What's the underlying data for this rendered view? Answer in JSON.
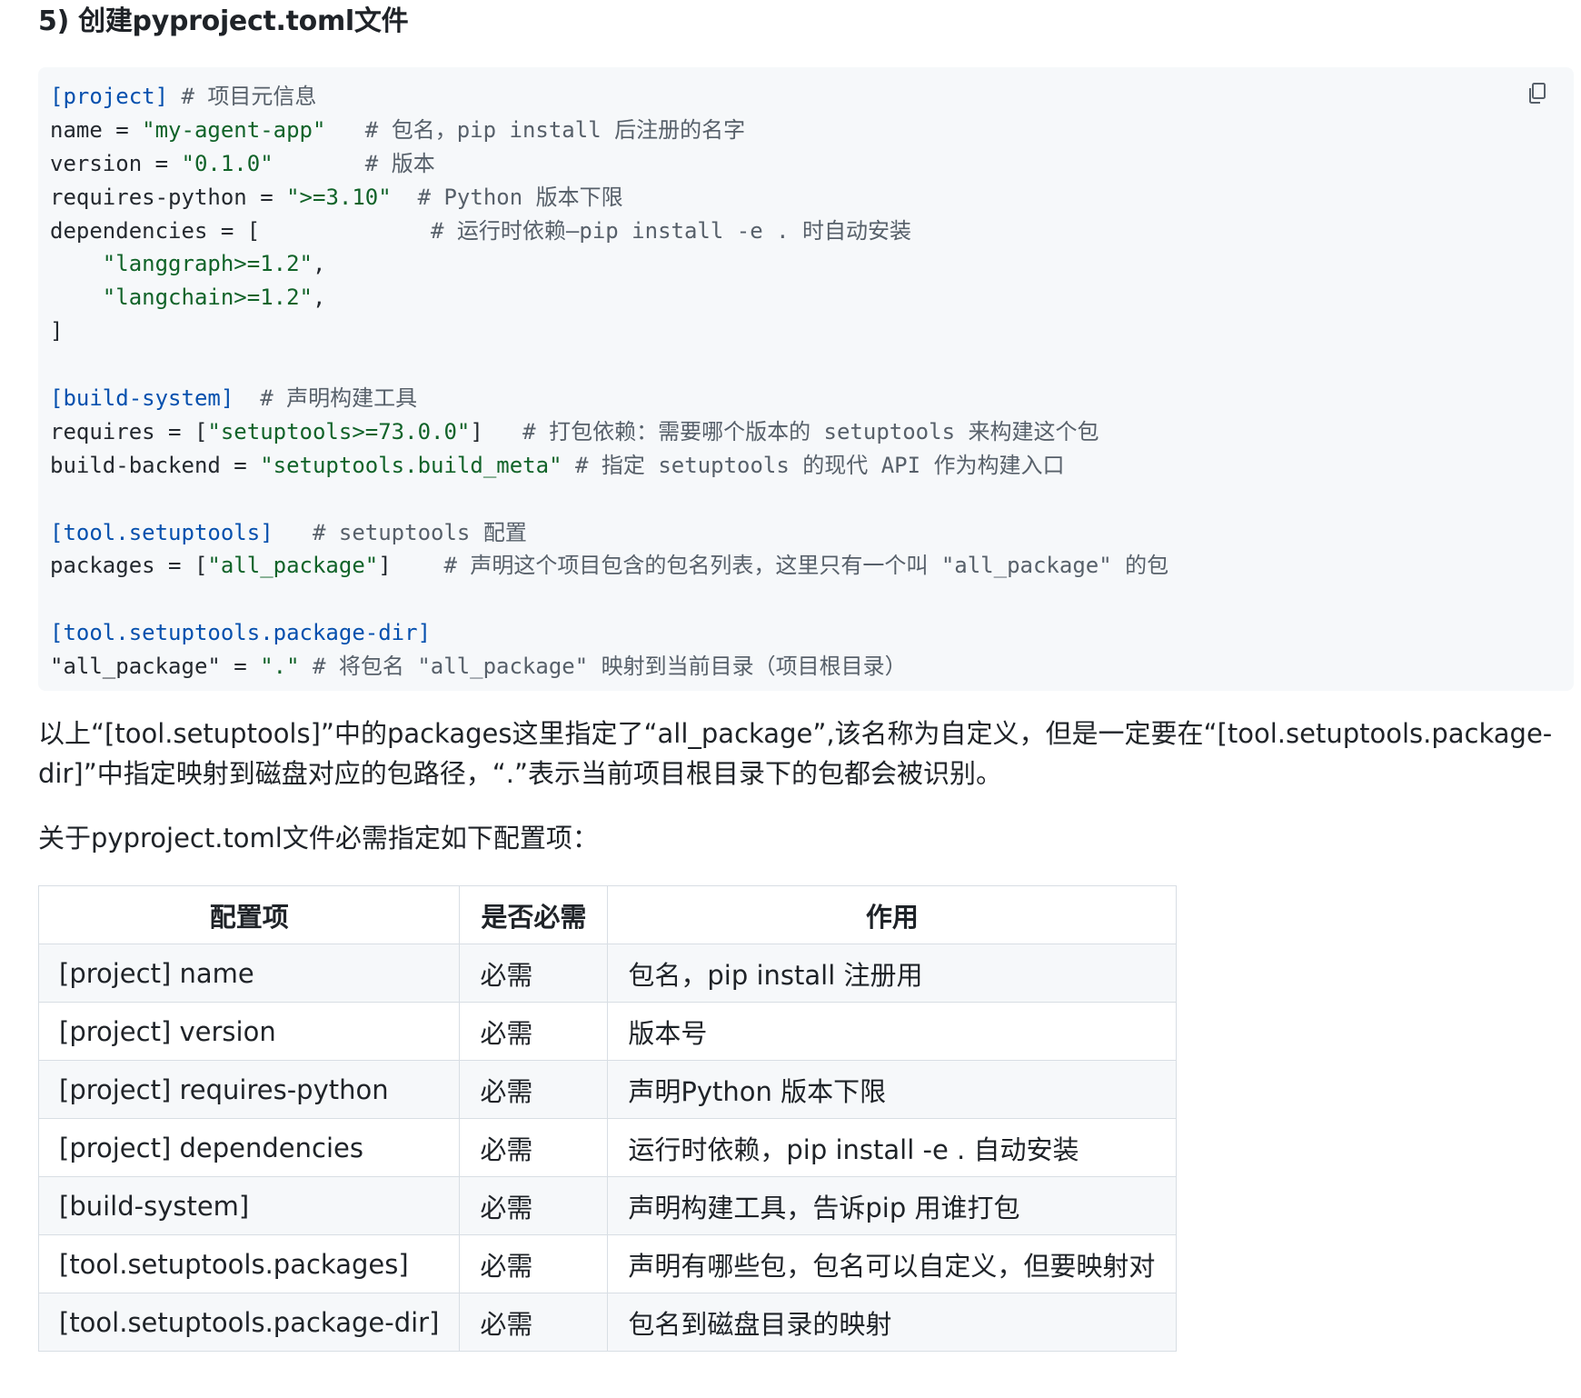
{
  "section_title": "5) 创建pyproject.toml文件",
  "code": {
    "copy_icon": "copy-icon",
    "lines": [
      [
        {
          "t": "[project]",
          "c": "section"
        },
        {
          "t": " # 项目元信息",
          "c": "comment"
        }
      ],
      [
        {
          "t": "name = ",
          "c": "plain"
        },
        {
          "t": "\"my-agent-app\"",
          "c": "str"
        },
        {
          "t": "   # 包名，pip install 后注册的名字",
          "c": "comment"
        }
      ],
      [
        {
          "t": "version = ",
          "c": "plain"
        },
        {
          "t": "\"0.1.0\"",
          "c": "str"
        },
        {
          "t": "       # 版本",
          "c": "comment"
        }
      ],
      [
        {
          "t": "requires-python = ",
          "c": "plain"
        },
        {
          "t": "\">=3.10\"",
          "c": "str"
        },
        {
          "t": "  # Python 版本下限",
          "c": "comment"
        }
      ],
      [
        {
          "t": "dependencies = [",
          "c": "plain"
        },
        {
          "t": "             # 运行时依赖—pip install -e . 时自动安装",
          "c": "comment"
        }
      ],
      [
        {
          "t": "    ",
          "c": "plain"
        },
        {
          "t": "\"langgraph>=1.2\"",
          "c": "str"
        },
        {
          "t": ",",
          "c": "plain"
        }
      ],
      [
        {
          "t": "    ",
          "c": "plain"
        },
        {
          "t": "\"langchain>=1.2\"",
          "c": "str"
        },
        {
          "t": ",",
          "c": "plain"
        }
      ],
      [
        {
          "t": "]",
          "c": "plain"
        }
      ],
      [],
      [
        {
          "t": "[build-system]",
          "c": "section"
        },
        {
          "t": "  # 声明构建工具",
          "c": "comment"
        }
      ],
      [
        {
          "t": "requires = [",
          "c": "plain"
        },
        {
          "t": "\"setuptools>=73.0.0\"",
          "c": "str"
        },
        {
          "t": "]",
          "c": "plain"
        },
        {
          "t": "   # 打包依赖：需要哪个版本的 setuptools 来构建这个包",
          "c": "comment"
        }
      ],
      [
        {
          "t": "build-backend = ",
          "c": "plain"
        },
        {
          "t": "\"setuptools.build_meta\"",
          "c": "str"
        },
        {
          "t": " # 指定 setuptools 的现代 API 作为构建入口",
          "c": "comment"
        }
      ],
      [],
      [
        {
          "t": "[tool.setuptools]",
          "c": "section"
        },
        {
          "t": "   # setuptools 配置",
          "c": "comment"
        }
      ],
      [
        {
          "t": "packages = [",
          "c": "plain"
        },
        {
          "t": "\"all_package\"",
          "c": "str"
        },
        {
          "t": "]",
          "c": "plain"
        },
        {
          "t": "    # 声明这个项目包含的包名列表，这里只有一个叫 \"all_package\" 的包",
          "c": "comment"
        }
      ],
      [],
      [
        {
          "t": "[tool.setuptools.package-dir]",
          "c": "section"
        }
      ],
      [
        {
          "t": "\"all_package\" = ",
          "c": "plain"
        },
        {
          "t": "\".\"",
          "c": "str"
        },
        {
          "t": " # 将包名 \"all_package\" 映射到当前目录（项目根目录）",
          "c": "comment"
        }
      ]
    ]
  },
  "paragraph_1": "以上“[tool.setuptools]”中的packages这里指定了“all_package”,该名称为自定义，但是一定要在“[tool.setuptools.package-dir]”中指定映射到磁盘对应的包路径，“.”表示当前项目根目录下的包都会被识别。",
  "paragraph_2": "关于pyproject.toml文件必需指定如下配置项：",
  "table": {
    "headers": [
      "配置项",
      "是否必需",
      "作用"
    ],
    "rows": [
      [
        "[project] name",
        "必需",
        "包名，pip install 注册用"
      ],
      [
        "[project] version",
        "必需",
        "版本号"
      ],
      [
        "[project] requires-python",
        "必需",
        "声明Python 版本下限"
      ],
      [
        "[project] dependencies",
        "必需",
        "运行时依赖，pip install -e . 自动安装"
      ],
      [
        "[build-system]",
        "必需",
        "声明构建工具，告诉pip 用谁打包"
      ],
      [
        "[tool.setuptools.packages]",
        "必需",
        "声明有哪些包，包名可以自定义，但要映射对"
      ],
      [
        "[tool.setuptools.package-dir]",
        "必需",
        "包名到磁盘目录的映射"
      ]
    ]
  }
}
